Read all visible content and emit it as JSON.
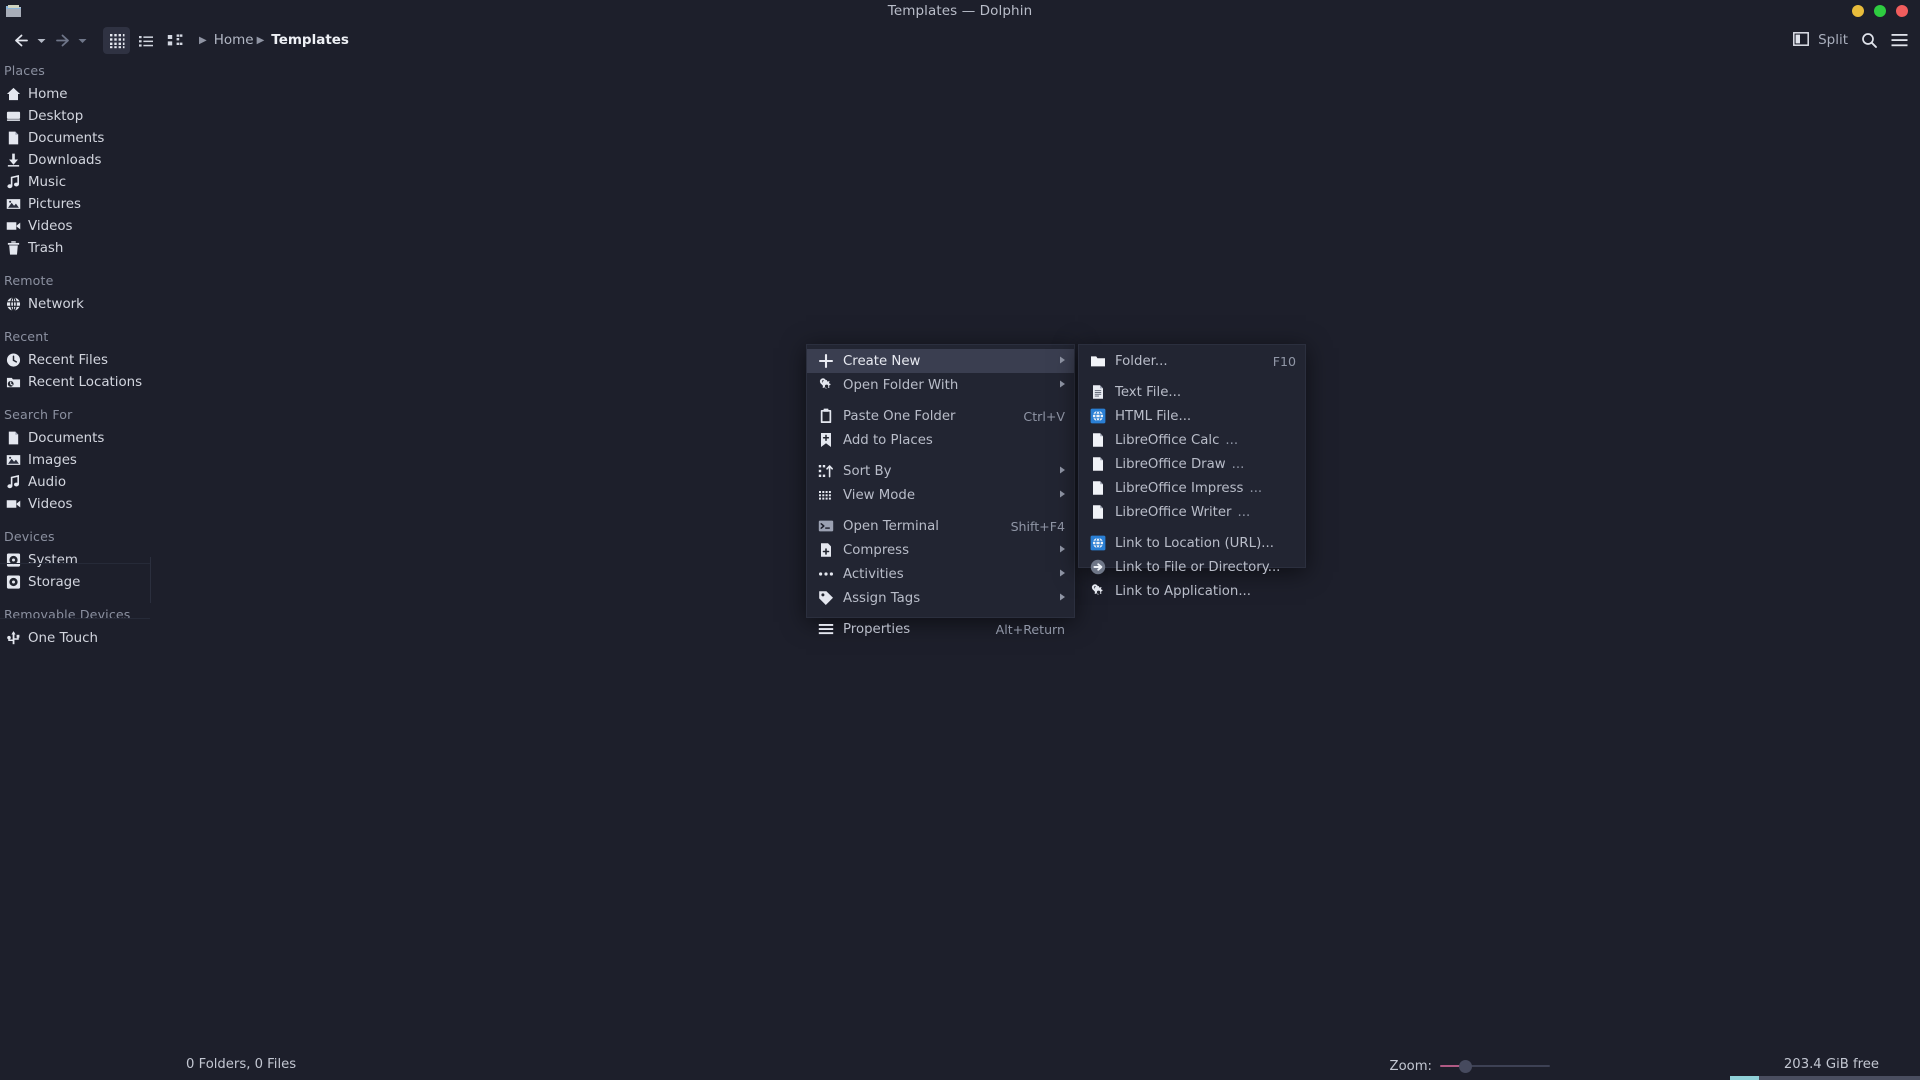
{
  "window": {
    "title": "Templates — Dolphin",
    "icon": "folder-icon",
    "controls": {
      "minimize": "minimize-button",
      "maximize": "maximize-button",
      "close": "close-button"
    }
  },
  "toolbar": {
    "back": "Back",
    "back_dropdown": "Back history",
    "forward": "Forward",
    "forward_dropdown": "Forward history",
    "icons_view": "Icons View",
    "compact_view": "Compact View",
    "details_view": "Details View",
    "split_label": "Split",
    "search": "Search",
    "menu": "Menu"
  },
  "breadcrumb": {
    "root_icon": "details-icon",
    "items": [
      "Home",
      "Templates"
    ]
  },
  "sidebar": {
    "groups": [
      {
        "title": "Places",
        "items": [
          {
            "label": "Home",
            "icon": "home-icon"
          },
          {
            "label": "Desktop",
            "icon": "desktop-icon"
          },
          {
            "label": "Documents",
            "icon": "document-icon"
          },
          {
            "label": "Downloads",
            "icon": "download-icon"
          },
          {
            "label": "Music",
            "icon": "music-icon"
          },
          {
            "label": "Pictures",
            "icon": "picture-icon"
          },
          {
            "label": "Videos",
            "icon": "video-icon"
          },
          {
            "label": "Trash",
            "icon": "trash-icon"
          }
        ]
      },
      {
        "title": "Remote",
        "items": [
          {
            "label": "Network",
            "icon": "network-icon"
          }
        ]
      },
      {
        "title": "Recent",
        "items": [
          {
            "label": "Recent Files",
            "icon": "clock-icon"
          },
          {
            "label": "Recent Locations",
            "icon": "recent-folder-icon"
          }
        ]
      },
      {
        "title": "Search For",
        "items": [
          {
            "label": "Documents",
            "icon": "document-icon"
          },
          {
            "label": "Images",
            "icon": "picture-icon"
          },
          {
            "label": "Audio",
            "icon": "music-icon"
          },
          {
            "label": "Videos",
            "icon": "video-icon"
          }
        ]
      },
      {
        "title": "Devices",
        "items": [
          {
            "label": "System",
            "icon": "disk-icon"
          },
          {
            "label": "Storage",
            "icon": "disk-icon"
          }
        ]
      },
      {
        "title": "Removable Devices",
        "items": [
          {
            "label": "One Touch",
            "icon": "usb-icon"
          }
        ]
      }
    ]
  },
  "context_menu": {
    "items": [
      {
        "label": "Create New",
        "icon": "plus-icon",
        "shortcut": "",
        "submenu": true,
        "highlighted": true,
        "separator_after": false
      },
      {
        "label": "Open Folder With",
        "icon": "open-with-icon",
        "shortcut": "",
        "submenu": true,
        "highlighted": false,
        "separator_after": true
      },
      {
        "label": "Paste One Folder",
        "icon": "paste-icon",
        "shortcut": "Ctrl+V",
        "submenu": false,
        "highlighted": false,
        "separator_after": false
      },
      {
        "label": "Add to Places",
        "icon": "bookmark-icon",
        "shortcut": "",
        "submenu": false,
        "highlighted": false,
        "separator_after": true
      },
      {
        "label": "Sort By",
        "icon": "sort-icon",
        "shortcut": "",
        "submenu": true,
        "highlighted": false,
        "separator_after": false
      },
      {
        "label": "View Mode",
        "icon": "grid-icon",
        "shortcut": "",
        "submenu": true,
        "highlighted": false,
        "separator_after": true
      },
      {
        "label": "Open Terminal",
        "icon": "terminal-icon",
        "shortcut": "Shift+F4",
        "submenu": false,
        "highlighted": false,
        "separator_after": false
      },
      {
        "label": "Compress",
        "icon": "compress-icon",
        "shortcut": "",
        "submenu": true,
        "highlighted": false,
        "separator_after": false
      },
      {
        "label": "Activities",
        "icon": "dots-icon",
        "shortcut": "",
        "submenu": true,
        "highlighted": false,
        "separator_after": false
      },
      {
        "label": "Assign Tags",
        "icon": "tag-icon",
        "shortcut": "",
        "submenu": true,
        "highlighted": false,
        "separator_after": true
      },
      {
        "label": "Properties",
        "icon": "properties-icon",
        "shortcut": "Alt+Return",
        "submenu": false,
        "highlighted": false,
        "separator_after": false
      }
    ]
  },
  "create_new_submenu": {
    "items": [
      {
        "label": "Folder...",
        "icon": "folder-white-icon",
        "shortcut": "F10",
        "ellipsis": "",
        "separator_after": true
      },
      {
        "label": "Text File...",
        "icon": "text-file-icon",
        "shortcut": "",
        "ellipsis": "",
        "separator_after": false
      },
      {
        "label": "HTML File...",
        "icon": "html-file-icon",
        "shortcut": "",
        "ellipsis": "",
        "separator_after": false
      },
      {
        "label": "LibreOffice Calc",
        "icon": "office-file-icon",
        "shortcut": "",
        "ellipsis": "...",
        "separator_after": false
      },
      {
        "label": "LibreOffice Draw",
        "icon": "office-file-icon",
        "shortcut": "",
        "ellipsis": "...",
        "separator_after": false
      },
      {
        "label": "LibreOffice Impress",
        "icon": "office-file-icon",
        "shortcut": "",
        "ellipsis": "...",
        "separator_after": false
      },
      {
        "label": "LibreOffice Writer",
        "icon": "office-file-icon",
        "shortcut": "",
        "ellipsis": "...",
        "separator_after": true
      },
      {
        "label": "Link to Location (URL)...",
        "icon": "html-file-icon",
        "shortcut": "",
        "ellipsis": "",
        "separator_after": false
      },
      {
        "label": "Link to File or Directory...",
        "icon": "link-arrow-icon",
        "shortcut": "",
        "ellipsis": "",
        "separator_after": false
      },
      {
        "label": "Link to Application...",
        "icon": "open-with-icon",
        "shortcut": "",
        "ellipsis": "",
        "separator_after": false
      }
    ]
  },
  "statusbar": {
    "count": "0 Folders, 0 Files",
    "zoom_label": "Zoom:",
    "free_space": "203.4 GiB free",
    "free_fill_percent": 15
  },
  "colors": {
    "background": "#1d1f2b",
    "menu_background": "#222532",
    "menu_highlight": "#3a3e50",
    "accent_blue": "#2a7fd4",
    "free_bar": "#8fd0d8",
    "zoom_accent": "#b05a84",
    "close": "#f15d5d",
    "maximize": "#2ecc40",
    "minimize": "#e8bc3b"
  }
}
